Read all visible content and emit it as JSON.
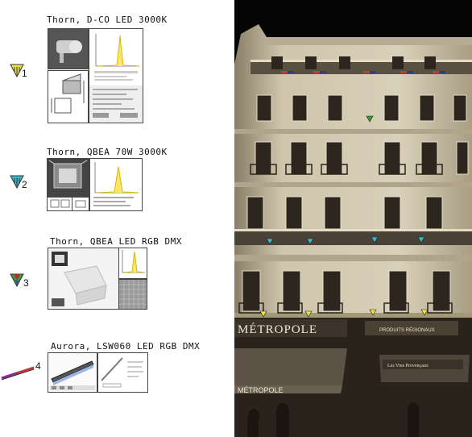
{
  "fixtures": [
    {
      "id": 1,
      "number": "1",
      "title": "Thorn, D-CO LED 3000K",
      "color": "#e9e14a"
    },
    {
      "id": 2,
      "number": "2",
      "title": "Thorn, QBEA 70W 3000K",
      "color": "#37b9c9"
    },
    {
      "id": 3,
      "number": "3",
      "title": "Thorn, QBEA LED RGB DMX",
      "color": "#3a9a3a"
    },
    {
      "id": 4,
      "number": "4",
      "title": "Aurora, LSW060 LED RGB DMX",
      "color": "#cc2b2b"
    }
  ],
  "photo": {
    "building": "Hotel façade (sepia photograph)",
    "sign_left": "MÉTROPOLE",
    "sign_awning": "MÉTROPOLE",
    "sign_shop": "PRODUITS RÉGIONAUX",
    "sign_shop2": "Les Vins Provençaux"
  },
  "colors": {
    "sepia_light": "#d8cfb8",
    "sepia_mid": "#a89c80",
    "sepia_dark": "#3a3228",
    "sky": "#050505"
  }
}
